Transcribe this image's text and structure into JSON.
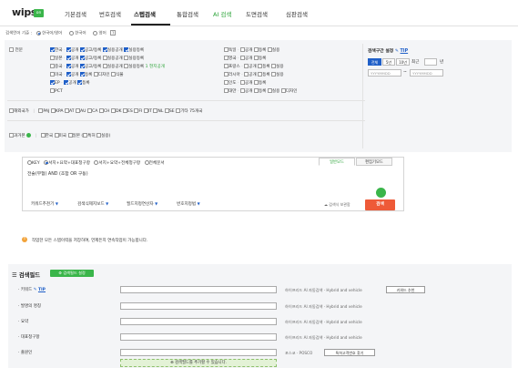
{
  "header": {
    "logo": "wips",
    "logo_badge": "on",
    "nav": [
      "기본검색",
      "번호검색",
      "스텝검색",
      "통합검색",
      "AI 검색",
      "도면검색",
      "심판검색"
    ]
  },
  "lang_row": {
    "label": "검색언어 기준 :",
    "options": [
      "한국어/영어",
      "한국어",
      "영어"
    ],
    "help": "?"
  },
  "country": {
    "main_label": "전문",
    "rows": [
      {
        "left": [
          "한국",
          "공개",
          "공고/등록",
          "실용공개",
          "실용등록"
        ],
        "right": [
          "독일",
          "공개",
          "등록",
          "실용"
        ]
      },
      {
        "left": [
          "일본",
          "공개",
          "공고/등록",
          "실용공개",
          "실용등록"
        ],
        "right": [
          "영국",
          "공개",
          "등록"
        ]
      },
      {
        "left": [
          "중국",
          "공개",
          "공고/등록",
          "실용공개",
          "실용등록",
          "1 현지공개"
        ],
        "right": [
          "프랑스",
          "공개",
          "등록",
          "실용"
        ]
      },
      {
        "left": [
          "미국",
          "공개",
          "등록",
          "디자인",
          "식물"
        ],
        "right": [
          "러시아",
          "공개",
          "등록",
          "실용"
        ]
      },
      {
        "left": [
          "EP",
          "공개",
          "등록"
        ],
        "right": [
          "인도",
          "공개",
          "등록"
        ]
      },
      {
        "left": [
          "PCT"
        ],
        "right": [
          "대만",
          "공개",
          "등록",
          "실용",
          "디자인"
        ]
      }
    ],
    "ext_label": "해외국가",
    "ext_items": [
      "PAJ",
      "KPA",
      "AT",
      "AU",
      "CA",
      "CH",
      "DK",
      "ES",
      "FI",
      "IT",
      "NL",
      "SE",
      "기타 75개국"
    ],
    "past_label": "과거본",
    "past_items": [
      "한국",
      "미국",
      "일본",
      "특허",
      "실용"
    ]
  },
  "date": {
    "label": "검색구간 설정",
    "tip": "TIP",
    "buttons": [
      "전체",
      "5년",
      "10년",
      "최근"
    ],
    "recent_unit": "년",
    "from_placeholder": "YYYYMMDD",
    "to_placeholder": "YYYYMMDD",
    "separator": "~"
  },
  "search": {
    "scope_options": [
      "KEY",
      "서지+요약+대표청구항",
      "서지+요약+전체청구항",
      "전체문서"
    ],
    "tabs": [
      "일반모드",
      "편집기모드"
    ],
    "query": "전술(무협) AND (조합 OR 구동)",
    "tools": [
      "키워드추천기",
      "검색식제지보드",
      "필드지정연산자",
      "번호지정법"
    ],
    "save_label": "검색식 보관함",
    "search_btn": "검색"
  },
  "notice": "작업한 모든 스텝이력을 저장하여, 언제든지 연속작업이 가능합니다.",
  "fields": {
    "title": "검색필드",
    "setting_btn": "검색필드 설정",
    "rows": [
      {
        "label": "· 키워드",
        "tip": "TIP",
        "help": "하이프리드 AI 자동검색 · Hybrid and vehicle",
        "button": "키워드 추천"
      },
      {
        "label": "· 발명의 명칭",
        "help": "하이프리드 AI 자동검색 · Hybrid and vehicle"
      },
      {
        "label": "· 요약",
        "help": "하이프리드 AI 자동검색 · Hybrid and vehicle"
      },
      {
        "label": "· 대표청구항",
        "help": "하이프리드 AI 자동검색 · Hybrid and vehicle"
      },
      {
        "label": "· 출원인",
        "help": "포스코 · POSCO",
        "button": "특허고객번호 찾기"
      }
    ],
    "add": "검색필드를 추가할 수 있습니다."
  }
}
